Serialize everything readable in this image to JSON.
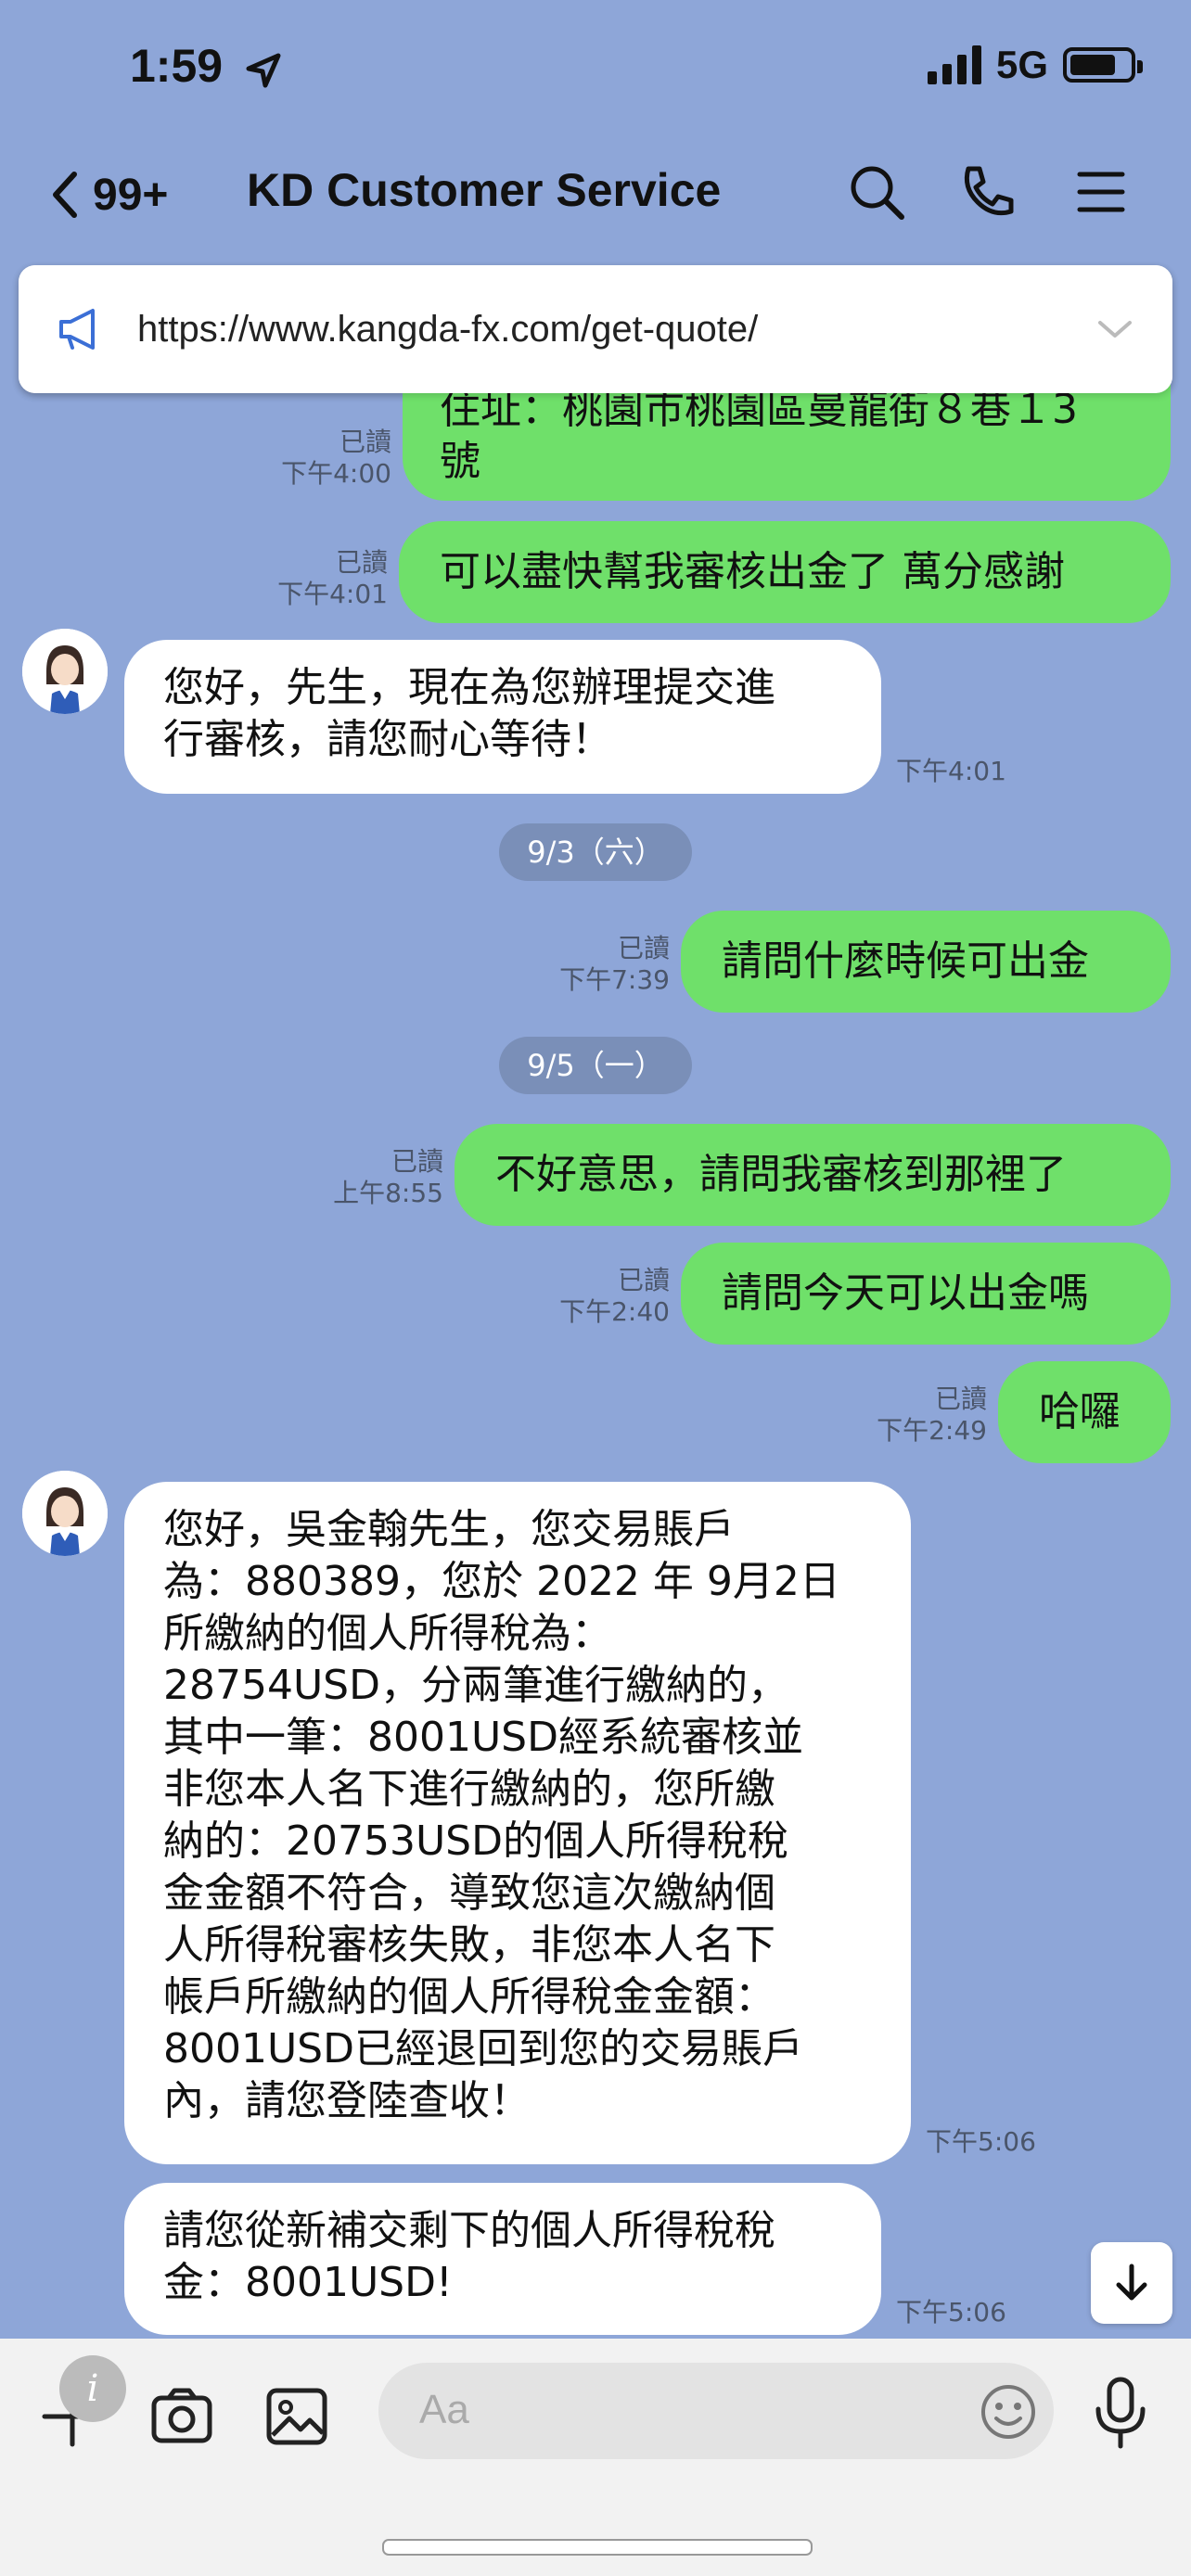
{
  "status": {
    "time": "1:59",
    "network": "5G"
  },
  "header": {
    "back_count": "99+",
    "title": "KD Customer Service"
  },
  "announcement": {
    "url": "https://www.kangda-fx.com/get-quote/"
  },
  "messages": {
    "m1": {
      "line1": "住址：桃園市桃園區曼龍街８巷１3",
      "line2": "號",
      "read": "已讀",
      "time": "下午4:00"
    },
    "m2": {
      "text": "可以盡快幫我審核出金了 萬分感謝",
      "read": "已讀",
      "time": "下午4:01"
    },
    "m3": {
      "line1": "您好，先生，現在為您辦理提交進",
      "line2": "行審核，請您耐心等待！",
      "time": "下午4:01"
    },
    "date1": "9/3（六）",
    "m4": {
      "text": "請問什麼時候可出金",
      "read": "已讀",
      "time": "下午7:39"
    },
    "date2": "9/5（一）",
    "m5": {
      "text": "不好意思，請問我審核到那裡了",
      "read": "已讀",
      "time": "上午8:55"
    },
    "m6": {
      "text": "請問今天可以出金嗎",
      "read": "已讀",
      "time": "下午2:40"
    },
    "m7": {
      "text": "哈囉",
      "read": "已讀",
      "time": "下午2:49"
    },
    "m8": {
      "lines": [
        "您好，吳金翰先生，您交易賬戶",
        "為：880389，您於 2022 年 9月2日",
        "所繳納的個人所得稅為：",
        "28754USD，分兩筆進行繳納的，",
        "其中一筆：8001USD經系統審核並",
        "非您本人名下進行繳納的，您所繳",
        "納的：20753USD的個人所得稅稅",
        "金金額不符合，導致您這次繳納個",
        "人所得稅審核失敗，非您本人名下",
        "帳戶所繳納的個人所得稅金金額：",
        "8001USD已經退回到您的交易賬戶",
        "內，請您登陸查收！"
      ],
      "time": "下午5:06"
    },
    "m9": {
      "line1": "請您從新補交剩下的個人所得稅稅",
      "line2": "金：8001USD!",
      "time": "下午5:06"
    }
  },
  "input": {
    "placeholder": "Aa"
  },
  "colors": {
    "background": "#8ea6d8",
    "my_bubble": "#6fe06a",
    "their_bubble": "#ffffff"
  }
}
